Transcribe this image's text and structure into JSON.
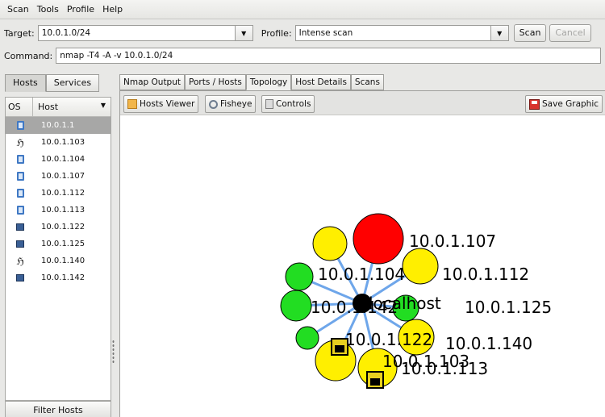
{
  "menu": [
    "Scan",
    "Tools",
    "Profile",
    "Help"
  ],
  "target": {
    "label": "Target:",
    "value": "10.0.1.0/24"
  },
  "profile": {
    "label": "Profile:",
    "value": "Intense scan"
  },
  "buttons": {
    "scan": "Scan",
    "cancel": "Cancel"
  },
  "command": {
    "label": "Command:",
    "value": "nmap -T4 -A -v 10.0.1.0/24"
  },
  "left_tabs": {
    "hosts": "Hosts",
    "services": "Services"
  },
  "host_list": {
    "col_os": "OS",
    "col_host": "Host",
    "rows": [
      {
        "os": "mac",
        "host": "10.0.1.1"
      },
      {
        "os": "linux",
        "host": "10.0.1.103"
      },
      {
        "os": "mac",
        "host": "10.0.1.104"
      },
      {
        "os": "mac",
        "host": "10.0.1.107"
      },
      {
        "os": "mac",
        "host": "10.0.1.112"
      },
      {
        "os": "mac",
        "host": "10.0.1.113"
      },
      {
        "os": "windows",
        "host": "10.0.1.122"
      },
      {
        "os": "windows",
        "host": "10.0.1.125"
      },
      {
        "os": "linux",
        "host": "10.0.1.140"
      },
      {
        "os": "windows",
        "host": "10.0.1.142"
      }
    ]
  },
  "filter_hosts": "Filter Hosts",
  "tabs": [
    "Nmap Output",
    "Ports / Hosts",
    "Topology",
    "Host Details",
    "Scans"
  ],
  "toolbar": {
    "hosts_viewer": "Hosts Viewer",
    "fisheye": "Fisheye",
    "controls": "Controls",
    "save_graphic": "Save Graphic"
  },
  "topology": {
    "center_label": "localhost",
    "node_labels": [
      "10.0.1.107",
      "10.0.1.112",
      "10.0.1.104",
      "10.0.1.142",
      "10.0.1.125",
      "10.0.1.122",
      "10.0.1.140",
      "10.0.1.103",
      "10.0.1.113"
    ],
    "colors": {
      "red": "#ff0000",
      "yellow": "#ffef00",
      "green": "#22dd22",
      "edge": "#6ea6ea"
    }
  }
}
